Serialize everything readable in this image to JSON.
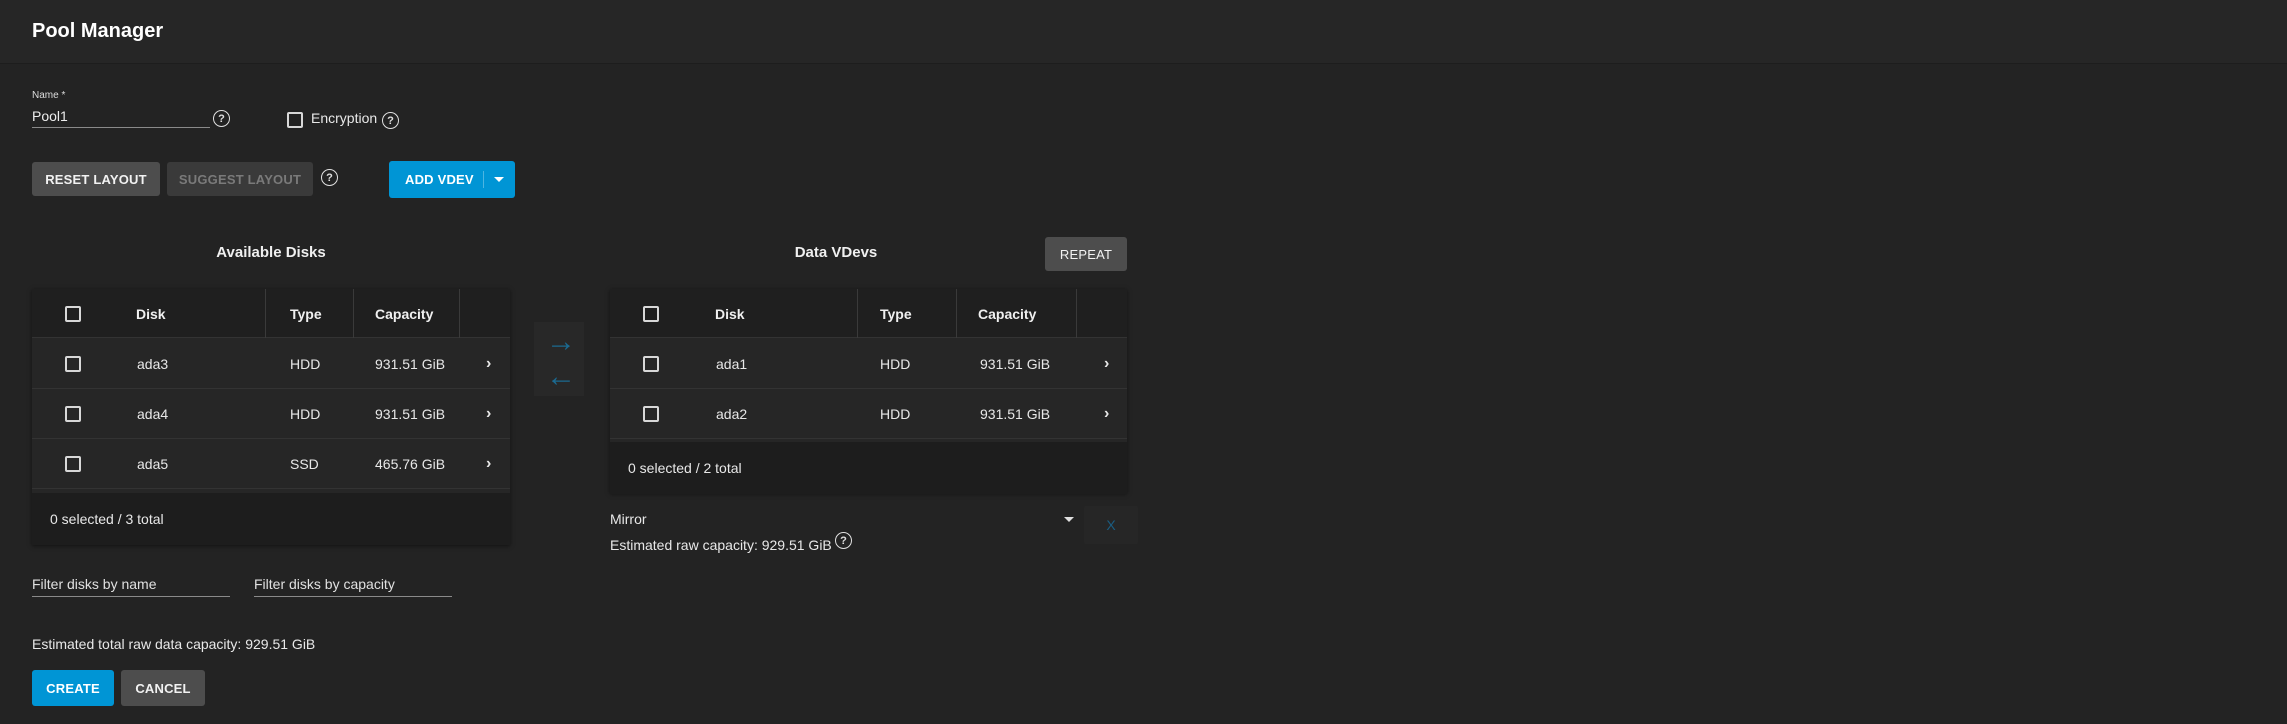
{
  "header": {
    "title": "Pool Manager"
  },
  "form": {
    "name_label": "Name *",
    "name_value": "Pool1",
    "encryption_label": "Encryption",
    "help_glyph": "?"
  },
  "toolbar": {
    "reset_layout": "RESET LAYOUT",
    "suggest_layout": "SUGGEST LAYOUT",
    "add_vdev": "ADD VDEV"
  },
  "available": {
    "title": "Available Disks",
    "columns": [
      "Disk",
      "Type",
      "Capacity"
    ],
    "rows": [
      {
        "disk": "ada3",
        "type": "HDD",
        "capacity": "931.51 GiB"
      },
      {
        "disk": "ada4",
        "type": "HDD",
        "capacity": "931.51 GiB"
      },
      {
        "disk": "ada5",
        "type": "SSD",
        "capacity": "465.76 GiB"
      }
    ],
    "footer": "0 selected / 3 total"
  },
  "transfer": {
    "right_arrow": "→",
    "left_arrow": "←"
  },
  "vdevs": {
    "title": "Data VDevs",
    "repeat_label": "REPEAT",
    "columns": [
      "Disk",
      "Type",
      "Capacity"
    ],
    "rows": [
      {
        "disk": "ada1",
        "type": "HDD",
        "capacity": "931.51 GiB"
      },
      {
        "disk": "ada2",
        "type": "HDD",
        "capacity": "931.51 GiB"
      }
    ],
    "footer": "0 selected / 2 total",
    "layout_value": "Mirror",
    "estimated": "Estimated raw capacity: 929.51 GiB",
    "remove_label": "X"
  },
  "filters": {
    "by_name_placeholder": "Filter disks by name",
    "by_capacity_placeholder": "Filter disks by capacity"
  },
  "summary": {
    "total_capacity": "Estimated total raw data capacity: 929.51 GiB"
  },
  "actions": {
    "create": "CREATE",
    "cancel": "CANCEL"
  },
  "icons": {
    "chevron": "›",
    "help": "help-circle-icon",
    "dropdown": "caret-down-icon"
  },
  "colors": {
    "accent": "#0095d5",
    "background": "#232323",
    "arrow": "#1b6a91"
  }
}
